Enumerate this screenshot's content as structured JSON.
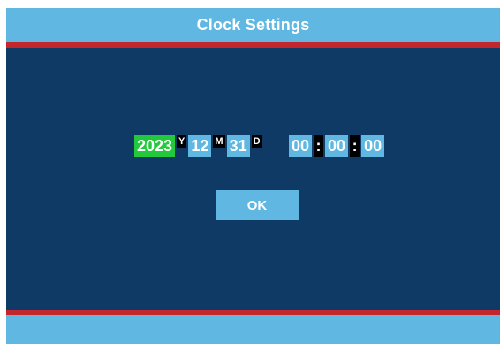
{
  "title": "Clock Settings",
  "date": {
    "year": "2023",
    "year_unit": "Y",
    "month": "12",
    "month_unit": "M",
    "day": "31",
    "day_unit": "D"
  },
  "time": {
    "hour": "00",
    "minute": "00",
    "second": "00",
    "separator": ":"
  },
  "ok_label": "OK",
  "colors": {
    "title_bar": "#5fb7e2",
    "accent_stripe": "#c3262c",
    "body_background": "#0f3a66",
    "field_background": "#5fb7e2",
    "active_field": "#22c93c",
    "unit_badge": "#000000"
  }
}
